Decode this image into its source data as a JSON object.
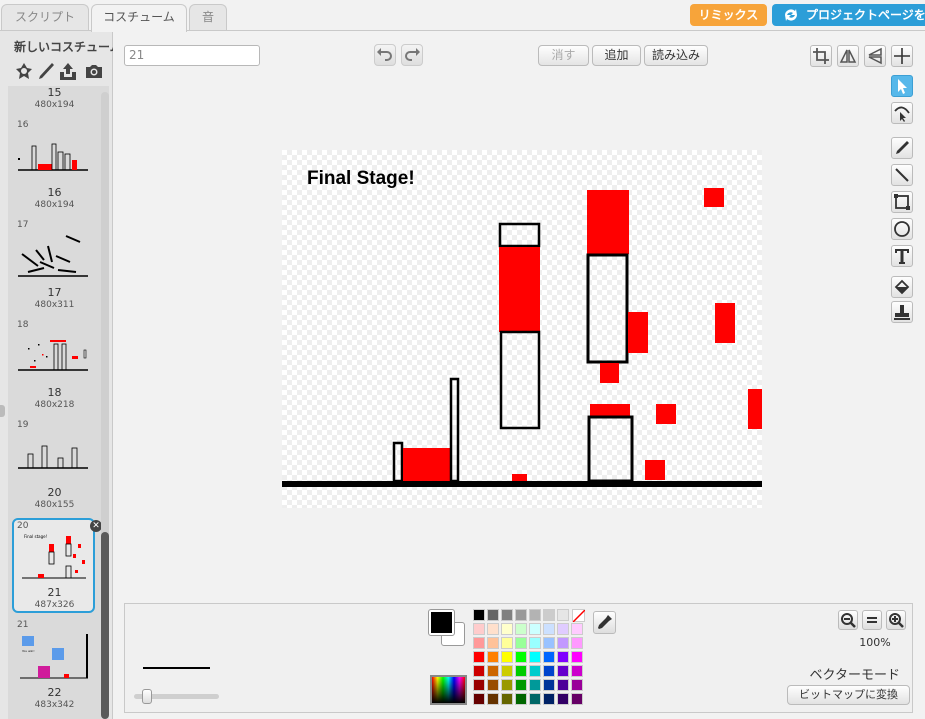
{
  "tabs": {
    "scripts": "スクリプト",
    "costumes": "コスチューム",
    "sounds": "音"
  },
  "header": {
    "remix": "リミックス",
    "project_page": "プロジェクトページを"
  },
  "left": {
    "new_costume": "新しいコスチューム:"
  },
  "costumes": [
    {
      "num": "",
      "name": "15",
      "size": "480x194"
    },
    {
      "num": "16",
      "name": "16",
      "size": "480x194"
    },
    {
      "num": "17",
      "name": "17",
      "size": "480x311"
    },
    {
      "num": "18",
      "name": "18",
      "size": "480x218"
    },
    {
      "num": "19",
      "name": "20",
      "size": "480x155"
    },
    {
      "num": "20",
      "name": "21",
      "size": "487x326"
    },
    {
      "num": "21",
      "name": "22",
      "size": "483x342"
    }
  ],
  "editor": {
    "costume_name": "21",
    "clear": "消す",
    "add": "追加",
    "import": "読み込み",
    "canvas_title": "Final Stage!",
    "thumb_title": "Final stage!",
    "thumb22_text": "You win!"
  },
  "bottom": {
    "zoom": "100%",
    "mode": "ベクターモード",
    "convert": "ビットマップに変換"
  },
  "colors": {
    "accent": "#2c9ed8",
    "remix": "#f7a43a",
    "shape": "#ff0000",
    "primary": "#000000",
    "secondary": "#ffffff"
  },
  "palette": [
    [
      "#000000",
      "#666666",
      "#808080",
      "#999999",
      "#b3b3b3",
      "#cccccc",
      "#e6e6e6",
      "#ffffff"
    ],
    [
      "#ffcccc",
      "#ffe0cc",
      "#ffffcc",
      "#ccffcc",
      "#ccffff",
      "#cce0ff",
      "#e0ccff",
      "#ffccff"
    ],
    [
      "#ff9999",
      "#ffc299",
      "#ffff99",
      "#99ff99",
      "#99ffff",
      "#99c2ff",
      "#c299ff",
      "#ff99ff"
    ],
    [
      "#ff0000",
      "#ff8000",
      "#ffff00",
      "#00ff00",
      "#00ffff",
      "#0066ff",
      "#8000ff",
      "#ff00ff"
    ],
    [
      "#cc0000",
      "#cc6600",
      "#cccc00",
      "#00cc00",
      "#00cccc",
      "#0044cc",
      "#6600cc",
      "#cc00cc"
    ],
    [
      "#990000",
      "#994c00",
      "#999900",
      "#009900",
      "#009999",
      "#003399",
      "#4c0099",
      "#990099"
    ],
    [
      "#660000",
      "#663300",
      "#666600",
      "#006600",
      "#006666",
      "#002266",
      "#330066",
      "#660066"
    ]
  ]
}
